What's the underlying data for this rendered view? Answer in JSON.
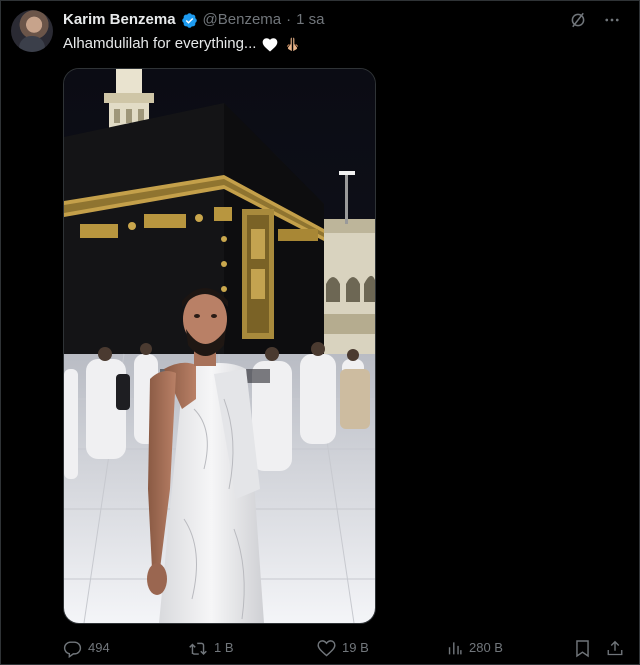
{
  "tweet": {
    "author_name": "Karim Benzema",
    "handle": "@Benzema",
    "separator": "·",
    "time": "1 sa",
    "text": "Alhamdulilah for everything...",
    "emojis": [
      "white-heart",
      "praying-hands"
    ]
  },
  "stats": {
    "replies": "494",
    "reposts": "1 B",
    "likes": "19 B",
    "views": "280 B"
  },
  "colors": {
    "background": "#000000",
    "text": "#e7e9ea",
    "muted": "#71767b",
    "verified": "#1d9bf0"
  },
  "icons": [
    "verified-badge-icon",
    "grok-icon",
    "more-icon",
    "reply-icon",
    "repost-icon",
    "like-icon",
    "views-icon",
    "bookmark-icon",
    "share-icon"
  ]
}
